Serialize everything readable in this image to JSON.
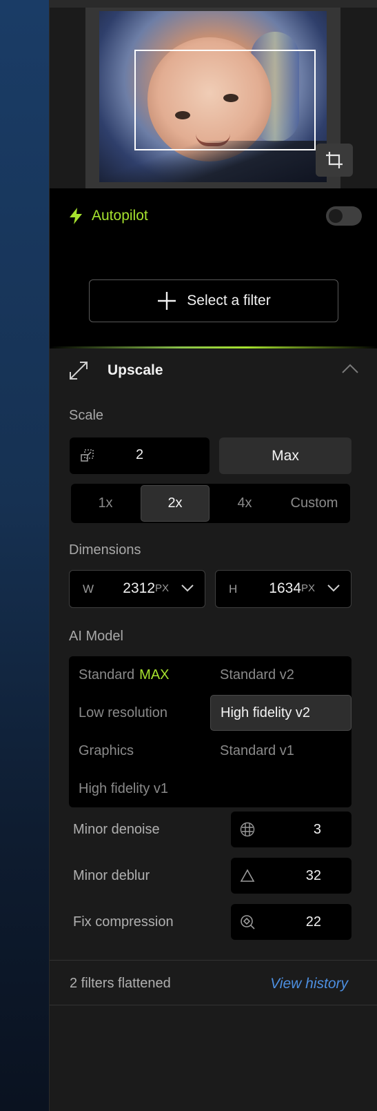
{
  "autopilot": {
    "label": "Autopilot",
    "enabled": false,
    "accent_color": "#a6e22e"
  },
  "filter": {
    "button_label": "Select a filter"
  },
  "upscale": {
    "title": "Upscale",
    "scale_label": "Scale",
    "scale_value": "2",
    "max_label": "Max",
    "presets": [
      "1x",
      "2x",
      "4x",
      "Custom"
    ],
    "active_preset": "2x",
    "dimensions_label": "Dimensions",
    "width": {
      "key": "W",
      "value": "2312",
      "unit": "PX"
    },
    "height": {
      "key": "H",
      "value": "1634",
      "unit": "PX"
    },
    "model_label": "AI Model",
    "models": {
      "standard_max": {
        "name": "Standard",
        "badge": "MAX"
      },
      "standard_v2": "Standard v2",
      "low_resolution": "Low resolution",
      "high_fidelity_v2": "High fidelity v2",
      "graphics": "Graphics",
      "standard_v1": "Standard v1",
      "high_fidelity_v1": "High fidelity v1"
    },
    "selected_model": "High fidelity v2",
    "params": {
      "denoise": {
        "label": "Minor denoise",
        "value": "3",
        "icon": "denoise-icon"
      },
      "deblur": {
        "label": "Minor deblur",
        "value": "32",
        "icon": "deblur-icon"
      },
      "compression": {
        "label": "Fix compression",
        "value": "22",
        "icon": "compression-icon"
      }
    }
  },
  "footer": {
    "flattened_text": "2 filters flattened",
    "history_link": "View history",
    "link_color": "#4d8fe0"
  }
}
